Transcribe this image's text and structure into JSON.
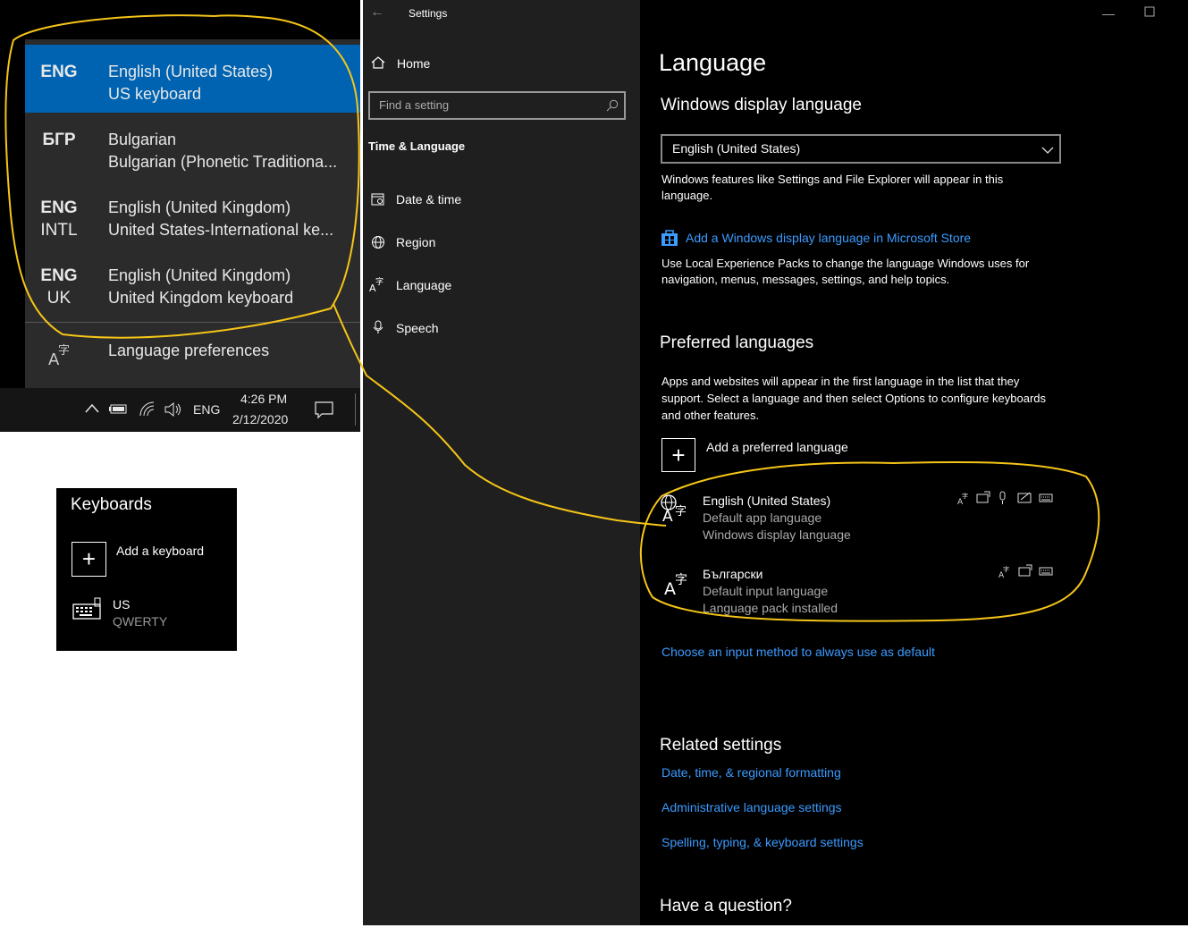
{
  "flyout": {
    "items": [
      {
        "code1": "ENG",
        "code2": "",
        "line1": "English (United States)",
        "line2": "US keyboard"
      },
      {
        "code1": "БГР",
        "code2": "",
        "line1": "Bulgarian",
        "line2": "Bulgarian (Phonetic Traditiona..."
      },
      {
        "code1": "ENG",
        "code2": "INTL",
        "line1": "English (United Kingdom)",
        "line2": "United States-International ke..."
      },
      {
        "code1": "ENG",
        "code2": "UK",
        "line1": "English (United Kingdom)",
        "line2": "United Kingdom keyboard"
      }
    ],
    "preferences_label": "Language preferences"
  },
  "taskbar": {
    "lang": "ENG",
    "time": "4:26 PM",
    "date": "2/12/2020"
  },
  "keyboards": {
    "title": "Keyboards",
    "add_label": "Add a keyboard",
    "kb_name": "US",
    "kb_layout": "QWERTY"
  },
  "nav": {
    "window_title": "Settings",
    "home": "Home",
    "search_placeholder": "Find a setting",
    "section": "Time & Language",
    "items": [
      "Date & time",
      "Region",
      "Language",
      "Speech"
    ]
  },
  "content": {
    "title": "Language",
    "display_heading": "Windows display language",
    "display_value": "English (United States)",
    "display_desc": "Windows features like Settings and File Explorer will appear in this language.",
    "store_link": "Add a Windows display language in Microsoft Store",
    "lxp_desc": "Use Local Experience Packs to change the language Windows uses for navigation, menus, messages, settings, and help topics.",
    "preferred_heading": "Preferred languages",
    "preferred_desc": "Apps and websites will appear in the first language in the list that they support. Select a language and then select Options to configure keyboards and other features.",
    "add_preferred": "Add a preferred language",
    "languages": [
      {
        "name": "English (United States)",
        "sub1": "Default app language",
        "sub2": "Windows display language"
      },
      {
        "name": "Български",
        "sub1": "Default input language",
        "sub2": "Language pack installed"
      }
    ],
    "input_method_link": "Choose an input method to always use as default",
    "related_heading": "Related settings",
    "related_links": [
      "Date, time, & regional formatting",
      "Administrative language settings",
      "Spelling, typing, & keyboard settings"
    ],
    "question_heading": "Have a question?"
  },
  "colors": {
    "accent": "#0063b1",
    "link": "#3b9bff",
    "annotation": "#f5c518"
  }
}
